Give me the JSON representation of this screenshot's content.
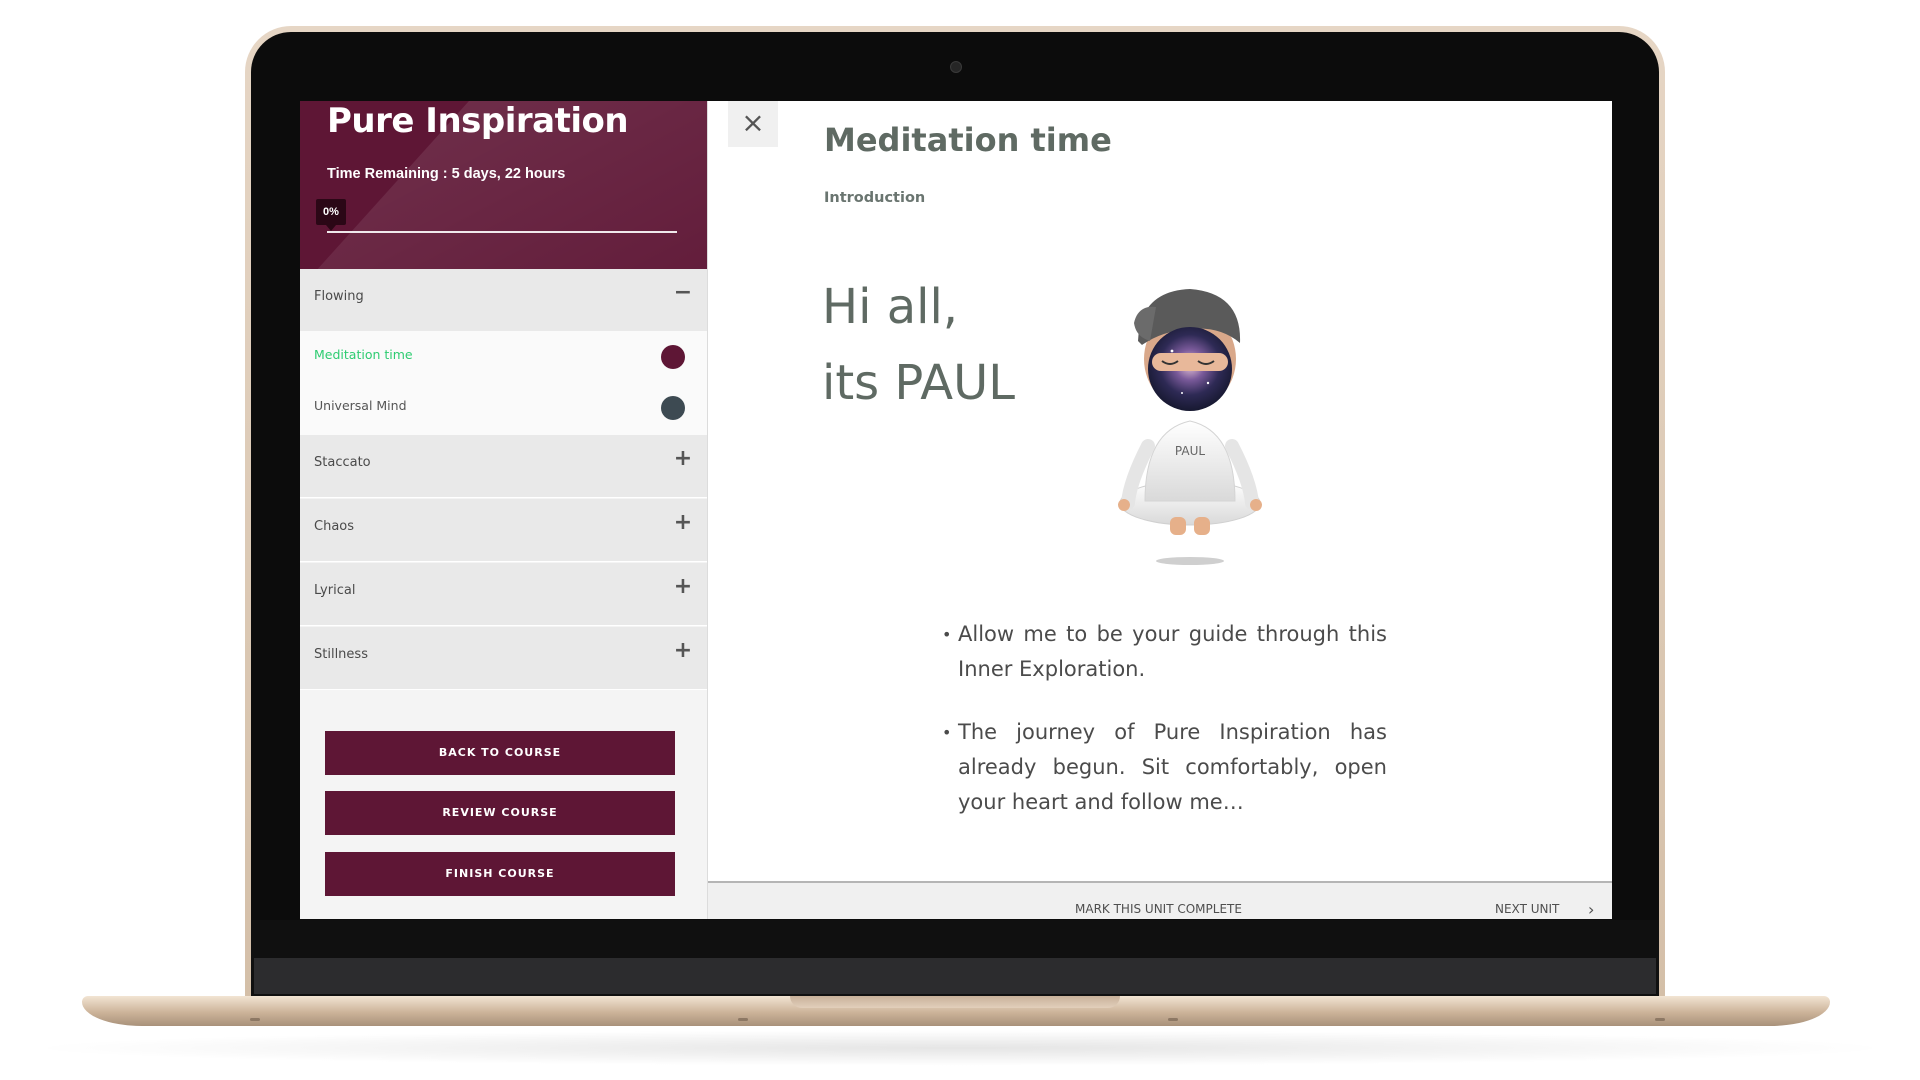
{
  "course": {
    "title": "Pure Inspiration",
    "time_remaining": "Time Remaining : 5 days, 22 hours",
    "progress_label": "0%",
    "progress_value": 0
  },
  "sections": [
    {
      "label": "Flowing",
      "toggle": "−",
      "expanded": true
    },
    {
      "label": "Staccato",
      "toggle": "+",
      "expanded": false
    },
    {
      "label": "Chaos",
      "toggle": "+",
      "expanded": false
    },
    {
      "label": "Lyrical",
      "toggle": "+",
      "expanded": false
    },
    {
      "label": "Stillness",
      "toggle": "+",
      "expanded": false
    }
  ],
  "units": [
    {
      "label": "Meditation time",
      "active": true,
      "dot_color": "#5e1635",
      "label_color": "#2ecc71"
    },
    {
      "label": "Universal Mind",
      "active": false,
      "dot_color": "#3d4a52",
      "label_color": "#555555"
    }
  ],
  "actions": {
    "back_to_course": "BACK TO COURSE",
    "review_course": "REVIEW COURSE",
    "finish_course": "FINISH COURSE"
  },
  "main": {
    "close_icon": "×",
    "title": "Meditation time",
    "subtitle": "Introduction",
    "greeting_line1": "Hi all,",
    "greeting_line2": "its PAUL",
    "illustration_label": "PAUL",
    "bullets": [
      "Allow me to be your guide through this Inner Exploration.",
      "The journey of Pure Inspiration has already begun. Sit comfortably, open your heart and follow me…"
    ]
  },
  "footer": {
    "mark_complete": "MARK THIS UNIT COMPLETE",
    "next_unit": "NEXT UNIT",
    "next_icon": "›"
  },
  "colors": {
    "brand": "#5e1635",
    "active_unit_text": "#2ecc71",
    "heading_gray": "#5f6a63"
  }
}
